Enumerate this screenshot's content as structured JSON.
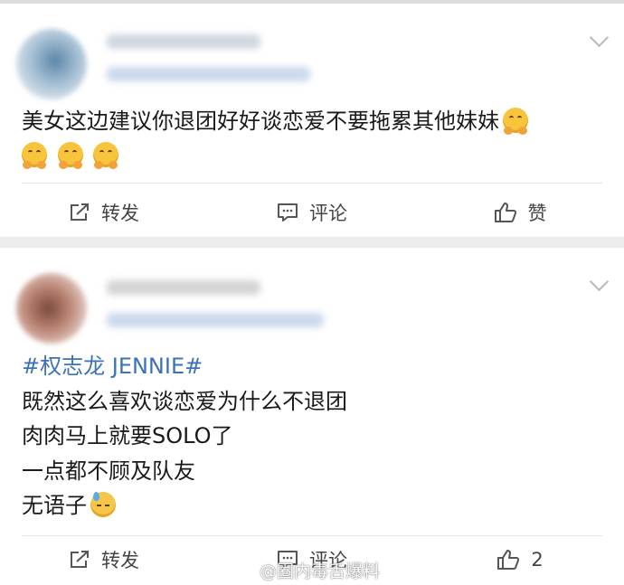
{
  "posts": [
    {
      "text_lines": [
        "美女这边建议你退团好好谈恋爱不要拖累其他妹妹"
      ],
      "emoji_line_count": 3,
      "actions": {
        "repost": "转发",
        "comment": "评论",
        "like": "赞"
      }
    },
    {
      "hashtag": "#权志龙 JENNIE#",
      "text_lines": [
        "既然这么喜欢谈恋爱为什么不退团",
        "肉肉马上就要SOLO了",
        "一点都不顾及队友",
        "无语子"
      ],
      "actions": {
        "repost": "转发",
        "comment": "评论",
        "like": "2"
      }
    }
  ],
  "watermark": "@圈内毒舌爆料",
  "icons": [
    "share-icon",
    "comment-icon",
    "thumbs-up-icon",
    "chevron-down-icon",
    "hugging-emoji",
    "sweat-emoji",
    "weibo-logo"
  ],
  "colors": {
    "hashtag": "#3c72b8",
    "card_bg": "#ffffff",
    "gap_bg": "#ededed"
  }
}
